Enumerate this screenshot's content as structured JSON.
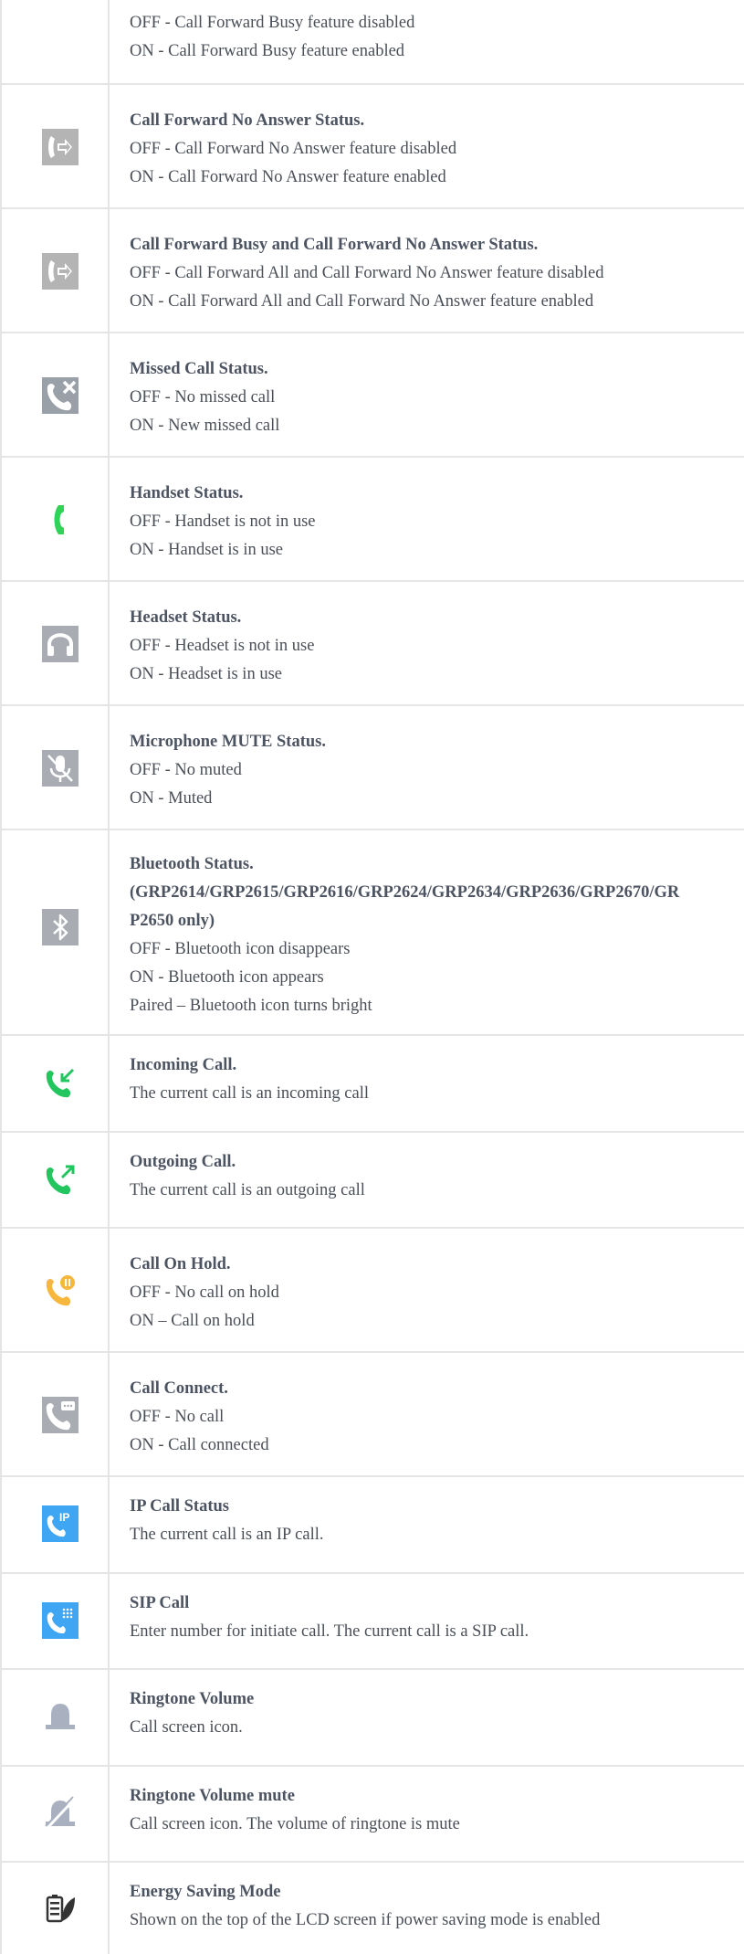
{
  "rows": [
    {
      "icon": "call-forward-busy-icon",
      "title": "",
      "lines": [
        "OFF - Call Forward Busy feature disabled",
        "ON - Call Forward Busy feature enabled"
      ]
    },
    {
      "icon": "call-forward-no-answer-icon",
      "title": "Call Forward No Answer Status.",
      "lines": [
        "OFF - Call Forward No Answer feature disabled",
        "ON - Call Forward No Answer feature enabled"
      ]
    },
    {
      "icon": "call-forward-busy-no-answer-icon",
      "title": "Call Forward Busy and Call Forward No Answer Status.",
      "lines": [
        "OFF - Call Forward All and Call Forward No Answer feature disabled",
        "ON - Call Forward All and Call Forward No Answer feature enabled"
      ]
    },
    {
      "icon": "missed-call-icon",
      "title": "Missed Call Status.",
      "lines": [
        "OFF - No missed call",
        "ON - New missed call"
      ]
    },
    {
      "icon": "handset-icon",
      "title": "Handset Status.",
      "lines": [
        "OFF - Handset is not in use",
        "ON - Handset is in use"
      ]
    },
    {
      "icon": "headset-icon",
      "title": "Headset Status.",
      "lines": [
        "OFF - Headset is not in use",
        "ON - Headset is in use"
      ]
    },
    {
      "icon": "microphone-mute-icon",
      "title": "Microphone MUTE Status.",
      "lines": [
        "OFF - No muted",
        "ON - Muted"
      ]
    },
    {
      "icon": "bluetooth-icon",
      "title": "Bluetooth Status.",
      "title2": "(GRP2614/GRP2615/GRP2616/GRP2624/GRP2634/GRP2636/GRP2670/GR",
      "title3": "P2650 only)",
      "lines": [
        "OFF - Bluetooth icon disappears",
        "ON - Bluetooth icon appears",
        "Paired – Bluetooth icon turns bright"
      ]
    },
    {
      "icon": "incoming-call-icon",
      "title": "Incoming Call.",
      "lines": [
        "The current call is an incoming call"
      ]
    },
    {
      "icon": "outgoing-call-icon",
      "title": "Outgoing Call.",
      "lines": [
        "The current call is an outgoing call"
      ]
    },
    {
      "icon": "call-on-hold-icon",
      "title": "Call On Hold.",
      "lines": [
        "OFF - No call on hold",
        "ON – Call on hold"
      ]
    },
    {
      "icon": "call-connect-icon",
      "title": "Call Connect.",
      "lines": [
        "OFF - No call",
        "ON - Call connected"
      ]
    },
    {
      "icon": "ip-call-icon",
      "title": "IP Call Status",
      "lines": [
        "The current call is an IP call."
      ]
    },
    {
      "icon": "sip-call-icon",
      "title": "SIP Call",
      "lines": [
        "Enter number for initiate call. The current call is a SIP call."
      ]
    },
    {
      "icon": "ringtone-volume-icon",
      "title": "Ringtone Volume",
      "lines": [
        "Call screen icon."
      ]
    },
    {
      "icon": "ringtone-volume-mute-icon",
      "title": "Ringtone Volume mute",
      "lines": [
        "Call screen icon. The volume of ringtone is mute"
      ]
    },
    {
      "icon": "energy-saving-icon",
      "title": "Energy Saving Mode",
      "lines": [
        "Shown on the top of the LCD screen if power saving mode is enabled"
      ]
    }
  ],
  "ip_badge": "IP"
}
